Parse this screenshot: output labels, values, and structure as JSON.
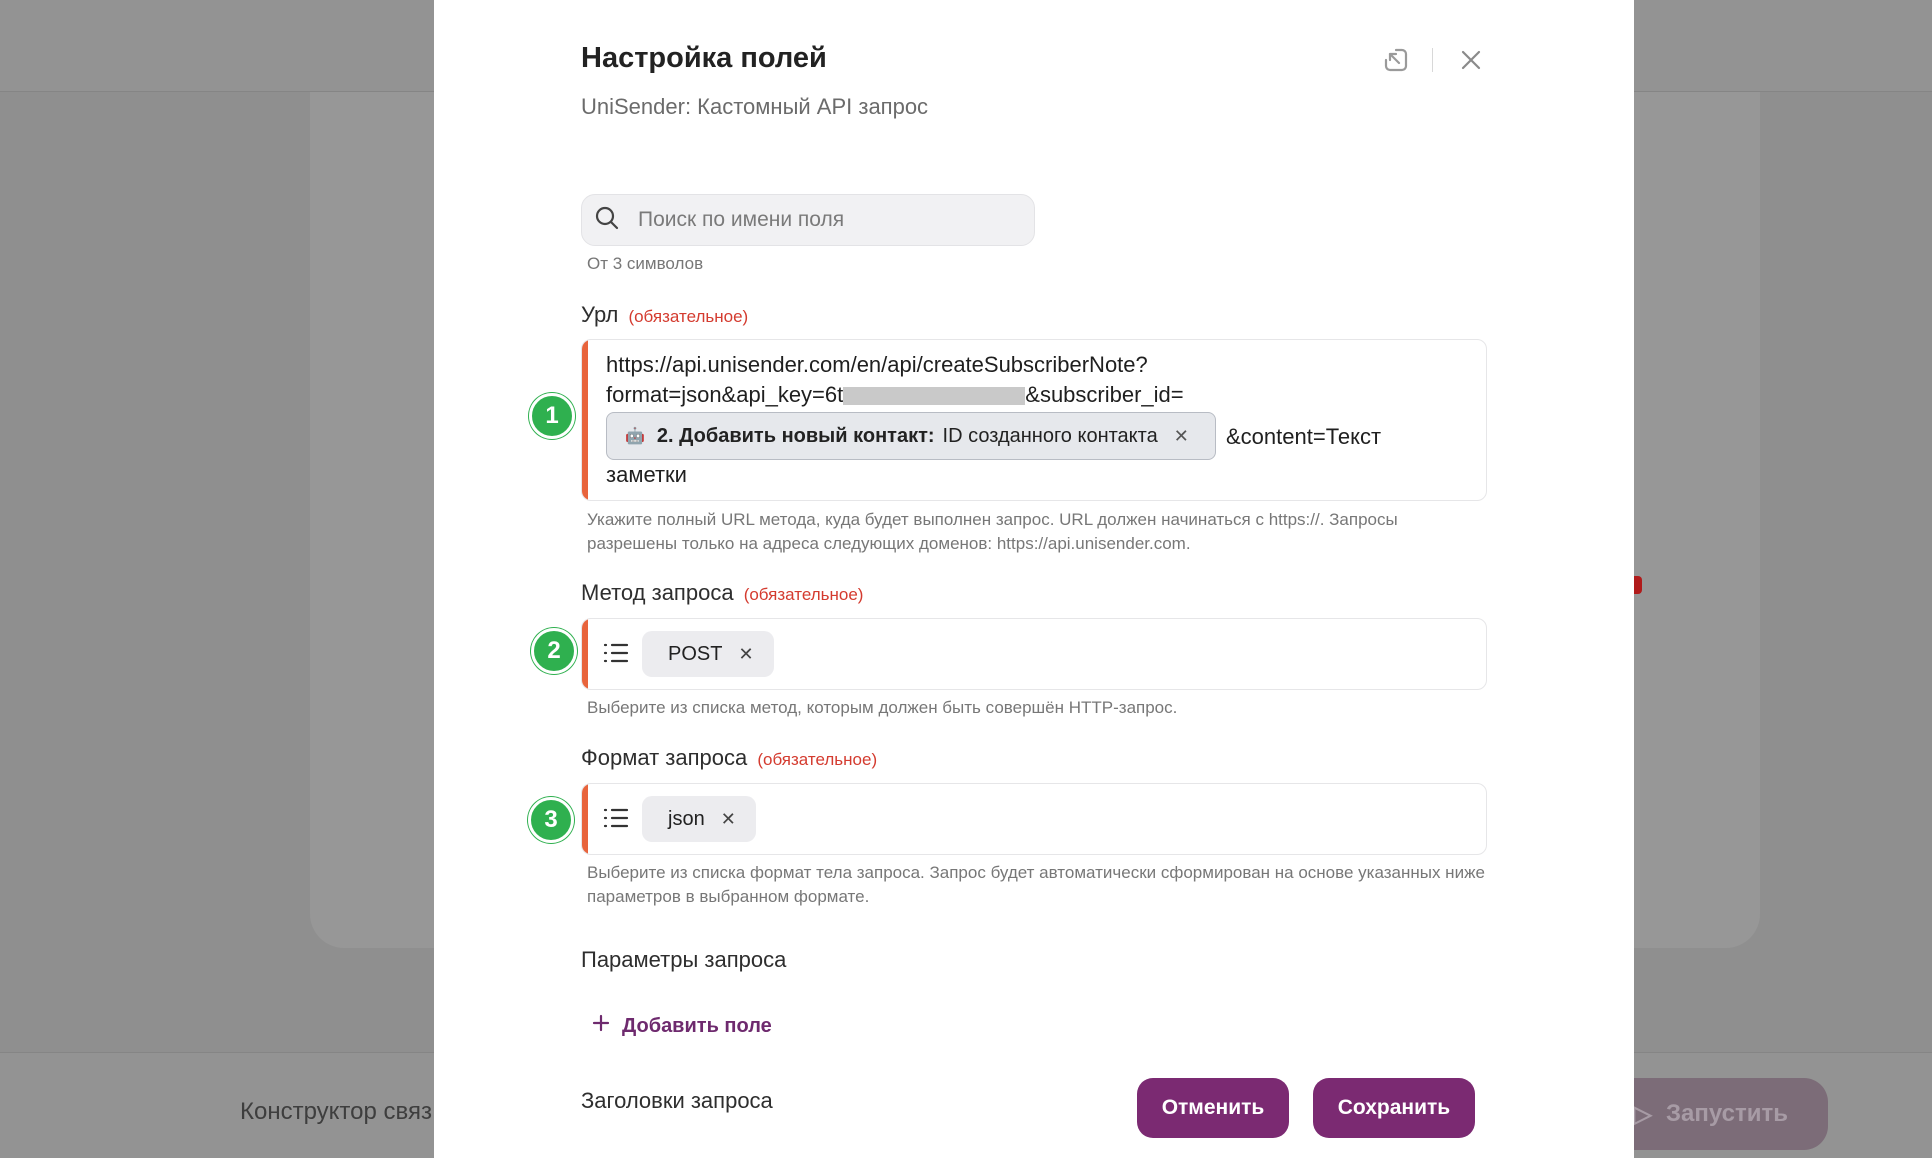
{
  "background": {
    "footer_text": "Конструктор связ",
    "run_label": "Запустить"
  },
  "modal": {
    "title": "Настройка полей",
    "subtitle": "UniSender: Кастомный API запрос",
    "search": {
      "placeholder": "Поиск по имени поля",
      "hint": "От 3 символов"
    },
    "required_text": "(обязательное)",
    "url_field": {
      "label": "Урл",
      "line1": "https://api.unisender.com/en/api/createSubscriberNote?",
      "line2_prefix": "format=json&api_key=6t",
      "line2_suffix": "&subscriber_id=",
      "chip_step": "2. Добавить новый контакт:",
      "chip_value": "ID созданного контакта",
      "after_chip": "&content=Текст",
      "line4": "заметки",
      "helper": "Укажите полный URL метода, куда будет выполнен запрос. URL должен начинаться с https://. Запросы разрешены только на адреса следующих доменов: https://api.unisender.com."
    },
    "method_field": {
      "label": "Метод запроса",
      "value": "POST",
      "helper": "Выберите из списка метод, которым должен быть совершён HTTP-запрос."
    },
    "format_field": {
      "label": "Формат запроса",
      "value": "json",
      "helper": "Выберите из списка формат тела запроса. Запрос будет автоматически сформирован на основе указанных ниже параметров в выбранном формате."
    },
    "params_label": "Параметры запроса",
    "add_field_label": "Добавить поле",
    "headers_label": "Заголовки запроса",
    "cancel_label": "Отменить",
    "save_label": "Сохранить"
  },
  "badges": [
    "1",
    "2",
    "3"
  ],
  "colors": {
    "accent": "#7b2a72",
    "required": "#d43b2f",
    "field_marker": "#e8643c",
    "badge": "#2fb04f"
  },
  "icons": {
    "header": [
      "collapse-icon",
      "close-icon"
    ],
    "search": "search-icon",
    "select": "list-icon",
    "chip_remove": "close-icon",
    "add": "plus-icon",
    "run": "play-icon"
  }
}
